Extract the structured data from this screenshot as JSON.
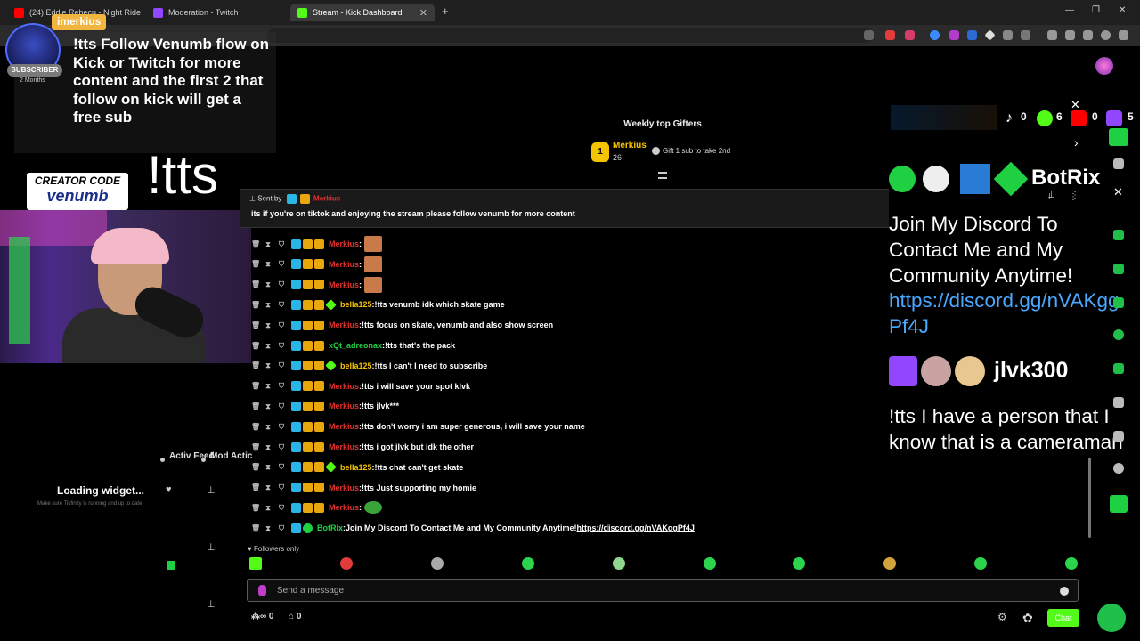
{
  "browser": {
    "tabs": [
      {
        "title": "(24) Eddie Rebecu - Night Ride",
        "active": false
      },
      {
        "title": "Moderation - Twitch",
        "active": false
      },
      {
        "title": "Stream - Kick Dashboard",
        "active": true
      }
    ],
    "new_tab": "+",
    "close_x": "✕",
    "win_min": "—",
    "win_max": "❐",
    "win_close": "✕"
  },
  "overlay": {
    "subscriber_name": "imerkius",
    "subscriber_tag": "SUBSCRIBER",
    "subscriber_months": "2 Months",
    "message": "!tts Follow Venumb flow on Kick or Twitch for more content and the first 2 that follow on kick will get a free sub",
    "big_tts": "!tts",
    "creator_code_label": "CREATOR CODE",
    "creator_code_name": "venumb"
  },
  "left_panel": {
    "activity_feed": "Activ Feed",
    "mod_actions": "Mod Actic",
    "loading": "Loading widget...",
    "loading_hint": "Make sure Tikfinity is running and up to date."
  },
  "gifters": {
    "title": "Weekly top Gifters",
    "rank": "1",
    "name": "Merkius",
    "count": "26",
    "cta": "Gift 1 sub to take 2nd"
  },
  "pinned": {
    "sent_by": "Sent by",
    "sender": "Merkius",
    "text": "its if you're on tiktok and enjoying the stream please follow venumb for more content"
  },
  "chat": {
    "messages": [
      {
        "user": "Merkius",
        "color": "#e2322f",
        "text": "",
        "emote": "face"
      },
      {
        "user": "Merkius",
        "color": "#e2322f",
        "text": "",
        "emote": "face"
      },
      {
        "user": "Merkius",
        "color": "#e2322f",
        "text": "",
        "emote": "face"
      },
      {
        "user": "bella125",
        "color": "#f4c400",
        "text": "!tts venumb idk which skate game",
        "emote": ""
      },
      {
        "user": "Merkius",
        "color": "#e2322f",
        "text": "!tts focus on skate, venumb and also show screen",
        "emote": ""
      },
      {
        "user": "xQt_adreonax",
        "color": "#1fd142",
        "text": "!tts that's the pack",
        "emote": ""
      },
      {
        "user": "bella125",
        "color": "#f4c400",
        "text": "!tts I can't I need to subscribe",
        "emote": ""
      },
      {
        "user": "Merkius",
        "color": "#e2322f",
        "text": "!tts i will save your spot klvk",
        "emote": ""
      },
      {
        "user": "Merkius",
        "color": "#e2322f",
        "text": "!tts jlvk***",
        "emote": ""
      },
      {
        "user": "Merkius",
        "color": "#e2322f",
        "text": "!tts don't worry i am super generous, i will save your name",
        "emote": ""
      },
      {
        "user": "Merkius",
        "color": "#e2322f",
        "text": "!tts i got jlvk but idk the other",
        "emote": ""
      },
      {
        "user": "bella125",
        "color": "#f4c400",
        "text": "!tts chat can't get skate",
        "emote": ""
      },
      {
        "user": "Merkius",
        "color": "#e2322f",
        "text": "!tts Just supporting my homie",
        "emote": ""
      },
      {
        "user": "Merkius",
        "color": "#e2322f",
        "text": "",
        "emote": "frog"
      },
      {
        "user": "BotRix",
        "color": "#1fd142",
        "text": "Join My Discord To Contact Me and My Community Anytime!",
        "link": "https://discord.gg/nVAKggPf4J",
        "emote": ""
      }
    ],
    "followers_only": "Followers only",
    "input_placeholder": "Send a message",
    "viewers_count": "0",
    "store_count": "0",
    "chat_button": "Chat"
  },
  "right_overlay": {
    "tiktok_count": "0",
    "kick_count": "6",
    "youtube_count": "0",
    "twitch_count": "5",
    "bot_name": "BotRix",
    "discord_text": "Join My Discord To Contact Me and My Community Anytime!",
    "discord_link": "https://discord.gg/nVAKggPf4J",
    "twitch_user": "jlvk300",
    "tts_text": "!tts I have a person that I know that is a cameraman"
  },
  "colors": {
    "kick_green": "#53fc18",
    "merkius_red": "#e2322f",
    "bella_gold": "#f4c400",
    "link_blue": "#4aa8ff"
  }
}
